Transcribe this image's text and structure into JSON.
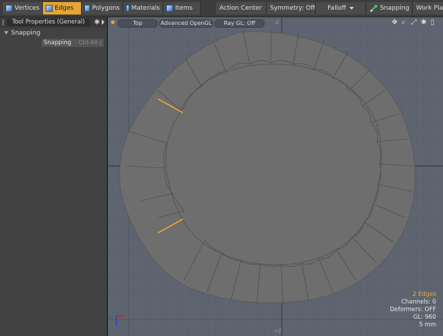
{
  "toolbar": {
    "modes": [
      {
        "label": "Vertices",
        "icon": "vertices-cube-icon",
        "active": false
      },
      {
        "label": "Edges",
        "icon": "edges-cube-icon",
        "active": true
      },
      {
        "label": "Polygons",
        "icon": "polygons-cube-icon",
        "active": false
      },
      {
        "label": "Materials",
        "icon": "materials-cube-icon",
        "active": false
      },
      {
        "label": "Items",
        "icon": "items-cube-icon",
        "active": false
      }
    ],
    "action_center": "Action Center",
    "symmetry": "Symmetry: Off",
    "falloff": "Falloff",
    "snapping": "Snapping",
    "work_plane": "Work Plane"
  },
  "left_panel": {
    "tab_title": "Tool Properties (General)",
    "section_title": "Snapping",
    "item_label": "Snapping",
    "item_shortcut": "Ctrl-Alt-J"
  },
  "viewport": {
    "view_label": "Top",
    "render_label": "Advanced OpenGL",
    "raygl_label": "Ray GL: Off",
    "info": {
      "selection": "2 Edges",
      "channels": "Channels: 0",
      "deformers": "Deformers: OFF",
      "gl": "GL: 960",
      "scale": "5 mm"
    },
    "colors": {
      "background": "#5d6470",
      "mesh": "#6e6e6e",
      "selected_edge": "#f0a830",
      "axis_x": "#d02020",
      "axis_y": "#2040d0"
    }
  }
}
